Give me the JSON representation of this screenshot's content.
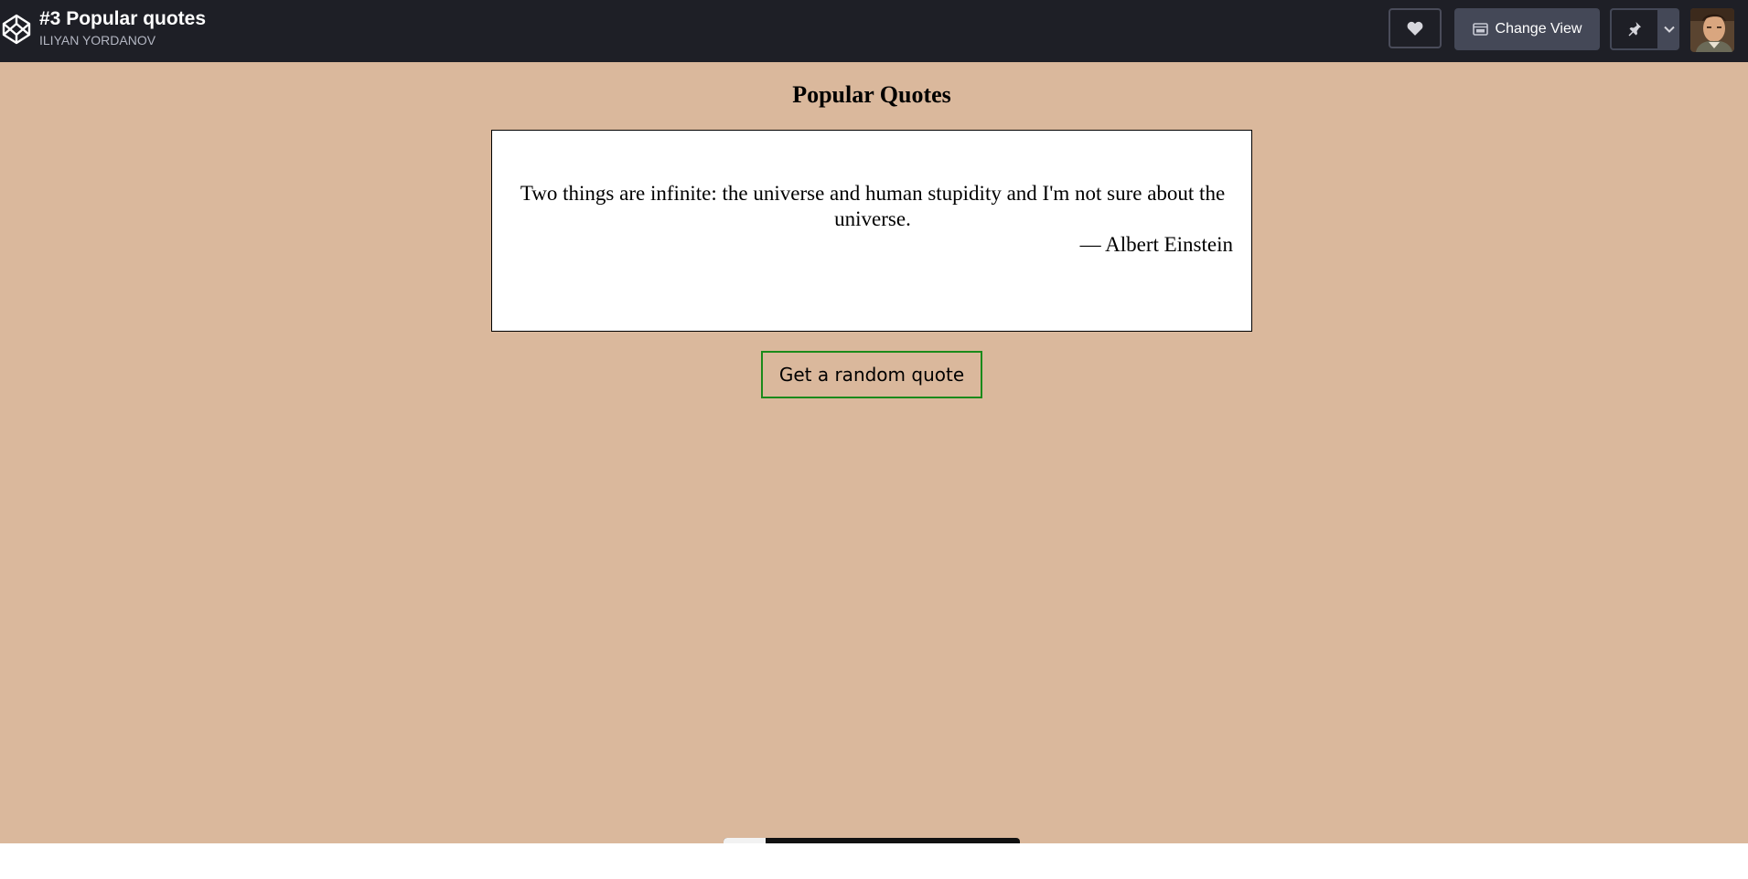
{
  "header": {
    "title": "#3 Popular quotes",
    "author": "ILIYAN YORDANOV",
    "change_view_label": "Change View",
    "icons": {
      "logo": "codepen-logo-icon",
      "heart": "heart-icon",
      "view": "change-view-icon",
      "pin": "pin-icon",
      "caret": "chevron-down-icon"
    }
  },
  "page": {
    "title": "Popular Quotes",
    "quote": {
      "text": "Two things are infinite: the universe and human stupidity and I'm not sure about the universe.",
      "author": "— Albert Einstein"
    },
    "button_label": "Get a random quote"
  },
  "colors": {
    "topbar": "#1e1f26",
    "stage_background": "#dab89c",
    "button_border": "#1a8a1a"
  }
}
